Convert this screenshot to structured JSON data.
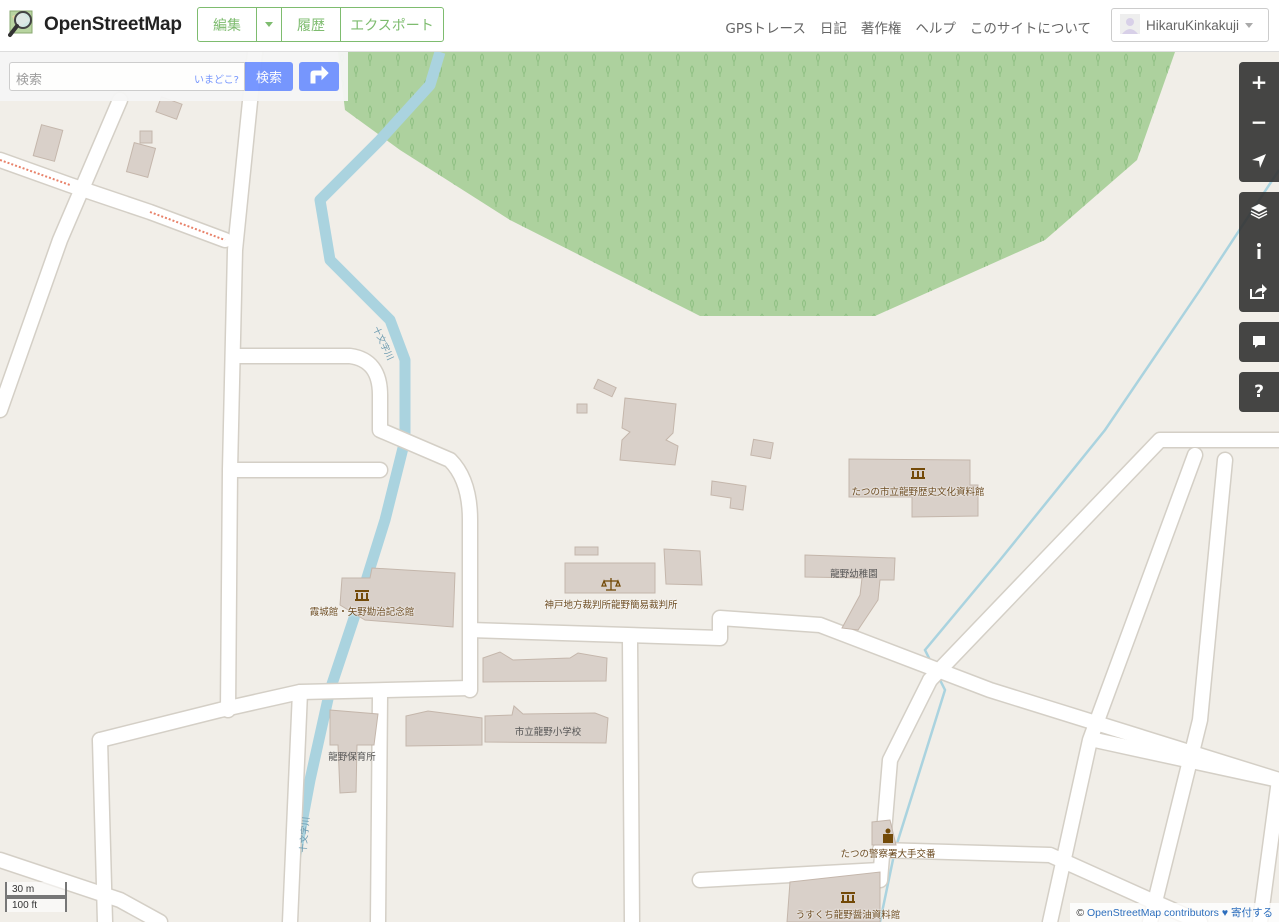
{
  "header": {
    "brand": "OpenStreetMap",
    "edit_label": "編集",
    "history_label": "履歴",
    "export_label": "エクスポート",
    "nav": [
      {
        "label": "GPSトレース"
      },
      {
        "label": "日記"
      },
      {
        "label": "著作権"
      },
      {
        "label": "ヘルプ"
      },
      {
        "label": "このサイトについて"
      }
    ],
    "username": "HikaruKinkakuji"
  },
  "search": {
    "placeholder": "検索",
    "where_am_i": "いまどこ?",
    "button_label": "検索"
  },
  "map": {
    "labels": {
      "museum1": "たつの市立龍野歴史文化資料館",
      "court": "神戸地方裁判所龍野簡易裁判所",
      "museum2": "霞城館・矢野勘治記念館",
      "kindergarten": "龍野幼稚園",
      "school": "市立龍野小学校",
      "nursery": "龍野保育所",
      "police": "たつの警察署大手交番",
      "museum3": "うすくち龍野醤油資料館",
      "river1": "十文字川",
      "river2": "十文字川"
    }
  },
  "scale": {
    "metric": "30 m",
    "imperial": "100 ft"
  },
  "attribution": {
    "prefix": "©",
    "link": "OpenStreetMap contributors",
    "donate": "♥ 寄付する"
  },
  "colors": {
    "accent_green": "#7ebc6f",
    "accent_blue": "#7092ff",
    "forest": "#add19e",
    "land": "#f1eee8",
    "building": "#d9d0c9",
    "water": "#aad3df"
  }
}
